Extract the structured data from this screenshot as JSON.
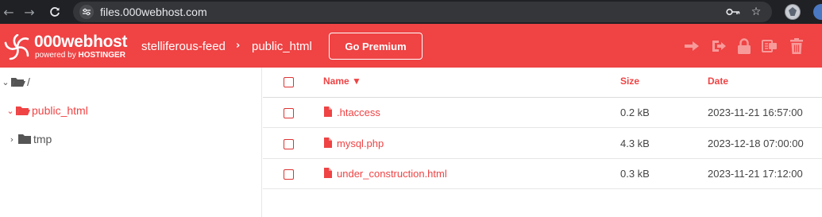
{
  "browser": {
    "url": "files.000webhost.com",
    "back_icon": "arrow-left-icon",
    "forward_icon": "arrow-right-icon",
    "reload_icon": "reload-icon",
    "site_info_icon": "tune-icon",
    "key_icon": "key-icon",
    "star_icon": "star-icon"
  },
  "header": {
    "brand": "000webhost",
    "brand_sub_prefix": "powered by",
    "brand_sub_name": "HOSTINGER",
    "breadcrumb_root": "stelliferous-feed",
    "breadcrumb_current": "public_html",
    "premium_label": "Go Premium",
    "toolbar_icons": [
      "move-icon",
      "export-icon",
      "lock-icon",
      "rename-icon",
      "trash-icon"
    ],
    "accent": "#ef4344"
  },
  "sidebar": {
    "items": [
      {
        "label": "/",
        "expanded": true,
        "active": false
      },
      {
        "label": "public_html",
        "expanded": true,
        "active": true
      },
      {
        "label": "tmp",
        "expanded": false,
        "active": false
      }
    ]
  },
  "table": {
    "columns": {
      "name": "Name ▼",
      "size": "Size",
      "date": "Date"
    },
    "rows": [
      {
        "name": ".htaccess",
        "size": "0.2 kB",
        "date": "2023-11-21 16:57:00"
      },
      {
        "name": "mysql.php",
        "size": "4.3 kB",
        "date": "2023-12-18 07:00:00"
      },
      {
        "name": "under_construction.html",
        "size": "0.3 kB",
        "date": "2023-11-21 17:12:00"
      }
    ]
  }
}
